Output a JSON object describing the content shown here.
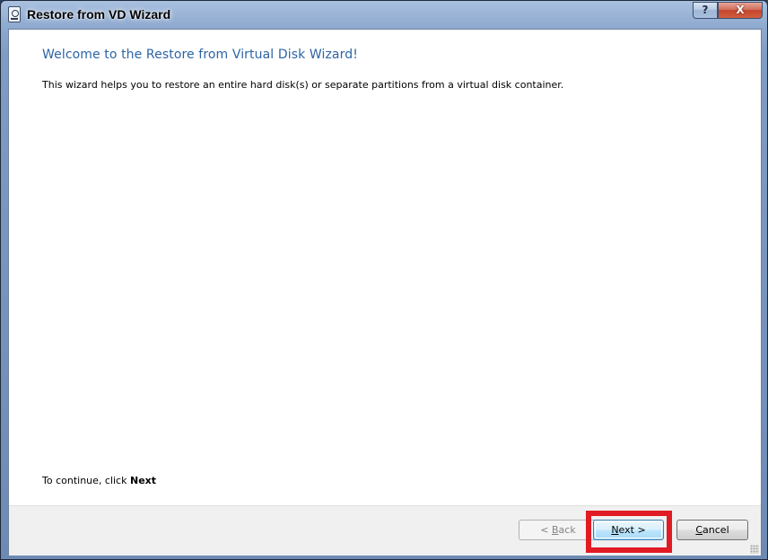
{
  "window": {
    "title": "Restore from VD Wizard",
    "help_label": "?",
    "close_label": "X"
  },
  "content": {
    "heading": "Welcome to the Restore from Virtual Disk Wizard!",
    "description": "This wizard helps you to restore an entire hard disk(s) or separate partitions from a virtual disk container.",
    "continue_prefix": "To continue, click ",
    "continue_emphasis": "Next"
  },
  "buttons": {
    "back": {
      "prefix": "< ",
      "mnemonic": "B",
      "rest": "ack",
      "enabled": false
    },
    "next": {
      "mnemonic": "N",
      "rest": "ext",
      "suffix": " >",
      "enabled": true
    },
    "cancel": {
      "mnemonic": "C",
      "rest": "ancel",
      "enabled": true
    }
  },
  "colors": {
    "heading": "#2c64a6",
    "highlight": "#e01b24",
    "title_gradient_top": "#a9c0df"
  }
}
